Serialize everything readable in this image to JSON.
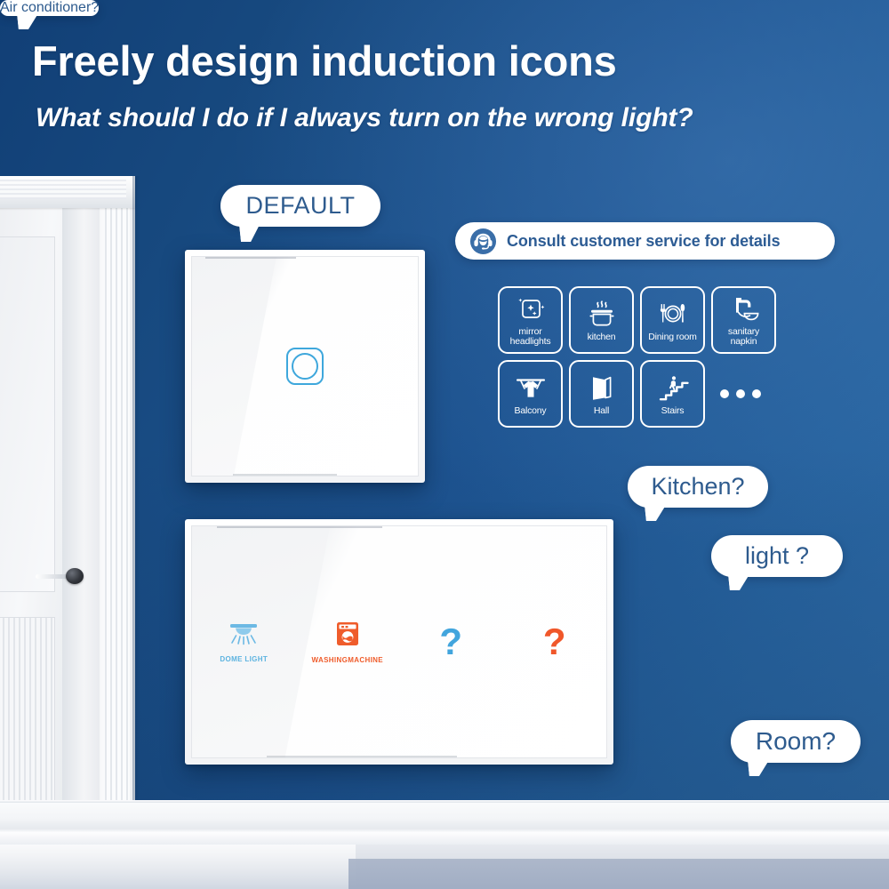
{
  "header": {
    "headline": "Freely design induction icons",
    "subheadline": "What should I do if I always turn on the wrong light?"
  },
  "consult": {
    "text": "Consult customer service for details",
    "icon": "headset-support-icon"
  },
  "icon_grid": {
    "rows": [
      [
        {
          "label": "mirror headlights",
          "icon": "mirror-sparkle-icon"
        },
        {
          "label": "kitchen",
          "icon": "cooking-pot-icon"
        },
        {
          "label": "Dining room",
          "icon": "plate-cutlery-icon"
        },
        {
          "label": "sanitary napkin",
          "icon": "faucet-basin-icon"
        }
      ],
      [
        {
          "label": "Balcony",
          "icon": "clothesline-icon"
        },
        {
          "label": "Hall",
          "icon": "open-door-icon"
        },
        {
          "label": "Stairs",
          "icon": "person-stairs-icon"
        }
      ]
    ],
    "more_indicator": "..."
  },
  "switch_top": {
    "badge": "DEFAULT",
    "button_icon": "touch-button-circle"
  },
  "switch_bottom": {
    "slots": [
      {
        "label": "DOME LIGHT",
        "icon": "dome-light-icon",
        "color": "#5cb3e0",
        "type": "icon"
      },
      {
        "label": "WASHINGMACHINE",
        "icon": "washing-machine-icon",
        "color": "#ef5c2b",
        "type": "icon"
      },
      {
        "label": "?",
        "icon": "question-mark-icon",
        "color": "#42a5dd",
        "type": "question"
      },
      {
        "label": "?",
        "icon": "question-mark-icon",
        "color": "#f0572a",
        "type": "question"
      }
    ]
  },
  "bubbles": [
    {
      "id": "kitchen",
      "text": "Kitchen?"
    },
    {
      "id": "light",
      "text": "light ?"
    },
    {
      "id": "air_conditioner",
      "text": "Air conditioner?"
    },
    {
      "id": "room",
      "text": "Room?"
    }
  ],
  "colors": {
    "wall_dark": "#113f76",
    "wall_light": "#2e6aa6",
    "bubble_text": "#2e5b8e",
    "accent_blue": "#42a5dd",
    "accent_orange": "#f0572a",
    "touch_ring": "#3ea7dc"
  }
}
